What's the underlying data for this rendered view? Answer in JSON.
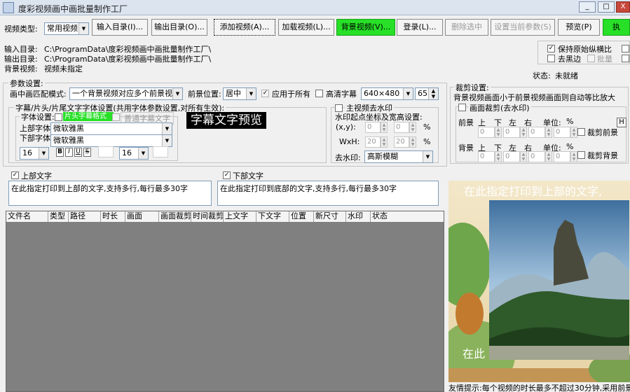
{
  "window": {
    "title": "度彩视频画中画批量制作工厂",
    "min": "_",
    "max": "□",
    "close": "X"
  },
  "toolbar": {
    "video_type_label": "视频类型:",
    "video_type_value": "常用视频",
    "input_dir": "输入目录(I)...",
    "output_dir": "输出目录(O)...",
    "add_video": "添加视频(A)...",
    "load_video": "加载视频(L)...",
    "bg_video": "背景视频(V)...",
    "login": "登录(L)...",
    "delete_selected": "删除选中",
    "set_current_params": "设置当前参数(S)",
    "preview": "预览(P)",
    "execute": "执"
  },
  "paths": {
    "input_label": "输入目录:",
    "input_value": "C:\\ProgramData\\度彩视频画中画批量制作工厂\\",
    "output_label": "输出目录:",
    "output_value": "C:\\ProgramData\\度彩视频画中画批量制作工厂\\",
    "bg_label": "背景视频:",
    "bg_value": "视频未指定"
  },
  "options": {
    "keep_ratio": "保持原始纵横比",
    "remove_black": "去黑边",
    "batch": "批量",
    "status_label": "状态:",
    "status_value": "未就绪"
  },
  "params": {
    "title": "参数设置:",
    "pip_mode_label": "画中画匹配模式:",
    "pip_mode_value": "一个背景视频对应多个前景视频",
    "fg_pos_label": "前景位置:",
    "fg_pos_value": "居中",
    "apply_all": "应用于所有",
    "hd_subtitle": "高清字幕",
    "resolution": "640×480",
    "fps": "65"
  },
  "font_group": {
    "title": "字幕/片头/片尾文字字体设置(共用字体参数设置,对所有生效):",
    "font_setting": "字体设置:",
    "tab_active": "片头字幕格式",
    "tab_normal": "普通字幕文字",
    "top_font_label": "上部字体",
    "bottom_font_label": "下部字体",
    "top_font": "微软雅黑",
    "bottom_font": "微软雅黑",
    "size1": "16",
    "size2": "16",
    "bold": "B",
    "italic": "I",
    "underline": "U",
    "strike": "S",
    "preview": "字幕文字预览"
  },
  "watermark": {
    "title": "主视频去水印",
    "coord_label": "水印起点坐标及宽高设置:",
    "xy_label": "(x,y):",
    "wh_label": "WxH:",
    "x": "0",
    "y": "0",
    "w": "20",
    "h": "20",
    "pct": "%",
    "method_label": "去水印:",
    "method_value": "高斯模糊"
  },
  "crop": {
    "title": "裁剪设置:",
    "desc": "背景视频画面小于前景视频画面则自动等比放大",
    "crop_check": "画面裁剪(去水印)",
    "h_button": "H",
    "fg_label": "前景",
    "bg_label": "背景",
    "top": "上",
    "bottom": "下",
    "left": "左",
    "right": "右",
    "unit": "单位:",
    "unit_value": "%",
    "crop_fg": "裁剪前景",
    "crop_bg": "裁剪背景",
    "zero": "0"
  },
  "top_text": {
    "label": "上部文字",
    "value": "在此指定打印到上部的文字,支持多行,每行最多30字"
  },
  "bottom_text": {
    "label": "下部文字",
    "value": "在此指定打印到底部的文字,支持多行,每行最多30字"
  },
  "table": {
    "columns": [
      "文件名",
      "类型",
      "路径",
      "时长",
      "画面",
      "画面裁剪",
      "时间裁剪",
      "上文字",
      "下文字",
      "位置",
      "新尺寸",
      "水印",
      "状态"
    ]
  },
  "preview_panel": {
    "top_overlay": "在此指定打印到上部的文字,",
    "bottom_overlay": "在此",
    "tip": "友情提示:每个视频的时长最多不超过30分钟,采用前景"
  },
  "colors": {
    "accent_green": "#27e027",
    "preview_bg": "#000000"
  }
}
